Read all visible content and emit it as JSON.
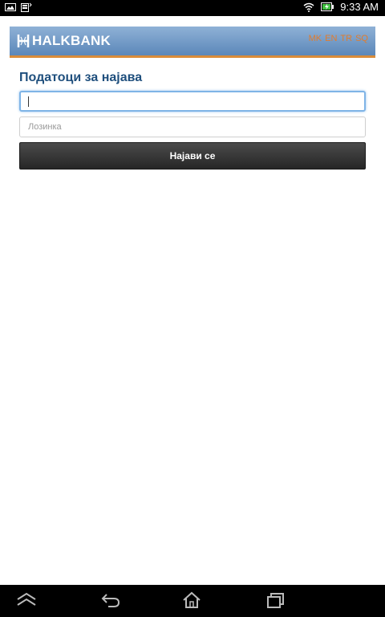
{
  "status_bar": {
    "time": "9:33 AM",
    "icons": [
      "gallery-icon",
      "phone-storage-icon",
      "wifi-icon",
      "battery-charging-icon"
    ]
  },
  "header": {
    "brand": "HALKBANK",
    "languages": [
      "MK",
      "EN",
      "TR",
      "SQ"
    ],
    "colors": {
      "header_top": "#8fb1d6",
      "header_bottom": "#5b87b9",
      "accent_border": "#d98c3a",
      "lang_text": "#e27c2c"
    }
  },
  "login": {
    "title": "Податоци за најава",
    "username_value": "",
    "password_placeholder": "Лозинка",
    "submit_label": "Најави се"
  },
  "nav_bar": {
    "icons": [
      "collapse-up-icon",
      "back-icon",
      "home-icon",
      "recent-apps-icon"
    ]
  }
}
